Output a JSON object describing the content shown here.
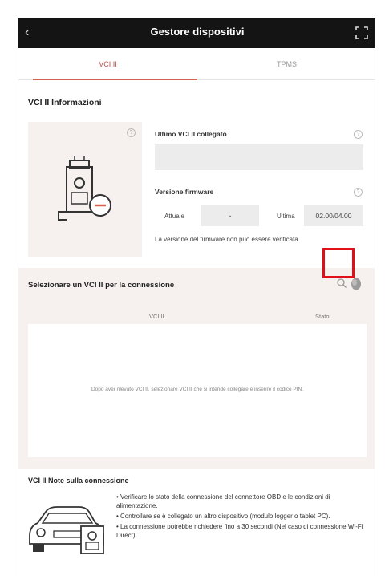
{
  "window": {
    "title": "Gestore dispositivi",
    "back_icon": "back-arrow-icon",
    "expand_icon": "expand-icon"
  },
  "tabs": [
    {
      "label": "VCI II",
      "active": true
    },
    {
      "label": "TPMS",
      "active": false
    }
  ],
  "info": {
    "section_title": "VCI II Informazioni",
    "last_connected_label": "Ultimo VCI II collegato",
    "last_connected_value": "",
    "firmware_label": "Versione firmware",
    "current_label": "Attuale",
    "current_value": "-",
    "latest_label": "Ultima",
    "latest_value": "02.00/04.00",
    "firmware_note": "La versione del firmware non può essere verificata."
  },
  "select": {
    "title": "Selezionare un VCI II per la connessione",
    "col_vci": "VCI II",
    "col_status": "Stato",
    "empty_message": "Dopo aver rilevato VCI II, selezionare VCI II che si intende collegare e inserire il codice PIN."
  },
  "notes": {
    "title": "VCI II Note sulla connessione",
    "items": [
      "• Verificare lo stato della connessione del connettore OBD e le condizioni di alimentazione.",
      "• Controllare se è collegato un altro dispositivo (modulo logger o tablet PC).",
      "• La connessione potrebbe richiedere fino a 30 secondi (Nel caso di connessione Wi-Fi Direct)."
    ]
  },
  "colors": {
    "titlebar": "#141414",
    "accent": "#d95f52",
    "panel_bg": "#f6f0ee",
    "highlight": "#e0101a"
  }
}
